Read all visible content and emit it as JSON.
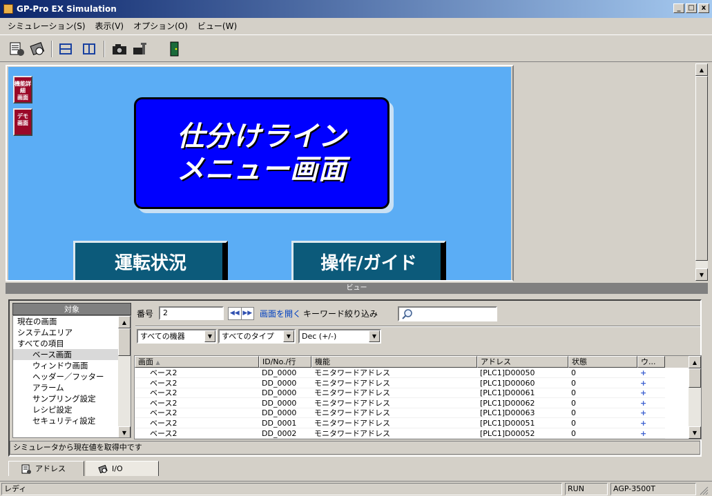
{
  "window": {
    "title": "GP-Pro EX Simulation",
    "min": "_",
    "max": "□",
    "close": "x"
  },
  "menu": [
    "シミュレーション(S)",
    "表示(V)",
    "オプション(O)",
    "ビュー(W)"
  ],
  "screen": {
    "side_buttons": [
      {
        "line1": "機能詳細",
        "line2": "画面"
      },
      {
        "line1": "デモ",
        "line2": "画面"
      }
    ],
    "title_line1": "仕分けライン",
    "title_line2": "メニュー画面",
    "btn_left": "運転状況",
    "btn_right": "操作/ガイド",
    "accent": "#5badf5"
  },
  "view_bar": "ビュー",
  "objects": {
    "header": "対象",
    "items": [
      {
        "label": "現在の画面",
        "sub": false,
        "selected": false
      },
      {
        "label": "システムエリア",
        "sub": false,
        "selected": false
      },
      {
        "label": "すべての項目",
        "sub": false,
        "selected": false
      },
      {
        "label": "ベース画面",
        "sub": true,
        "selected": true
      },
      {
        "label": "ウィンドウ画面",
        "sub": true,
        "selected": false
      },
      {
        "label": "ヘッダー／フッター",
        "sub": true,
        "selected": false
      },
      {
        "label": "アラーム",
        "sub": true,
        "selected": false
      },
      {
        "label": "サンプリング設定",
        "sub": true,
        "selected": false
      },
      {
        "label": "レシピ設定",
        "sub": true,
        "selected": false
      },
      {
        "label": "セキュリティ設定",
        "sub": true,
        "selected": false
      }
    ]
  },
  "filter": {
    "number_label": "番号",
    "number_value": "2",
    "open_screen": "画面を開く",
    "keyword_label": "キーワード絞り込み",
    "device": "すべての機器",
    "type": "すべてのタイプ",
    "format": "Dec (+/-)"
  },
  "table": {
    "columns": [
      "画面",
      "ID/No./行",
      "機能",
      "アドレス",
      "状態",
      "ウ..."
    ],
    "rows": [
      [
        "ベース2",
        "DD_0000",
        "モニタワードアドレス",
        "[PLC1]D00050",
        "0",
        "+"
      ],
      [
        "ベース2",
        "DD_0000",
        "モニタワードアドレス",
        "[PLC1]D00060",
        "0",
        "+"
      ],
      [
        "ベース2",
        "DD_0000",
        "モニタワードアドレス",
        "[PLC1]D00061",
        "0",
        "+"
      ],
      [
        "ベース2",
        "DD_0000",
        "モニタワードアドレス",
        "[PLC1]D00062",
        "0",
        "+"
      ],
      [
        "ベース2",
        "DD_0000",
        "モニタワードアドレス",
        "[PLC1]D00063",
        "0",
        "+"
      ],
      [
        "ベース2",
        "DD_0001",
        "モニタワードアドレス",
        "[PLC1]D00051",
        "0",
        "+"
      ],
      [
        "ベース2",
        "DD_0002",
        "モニタワードアドレス",
        "[PLC1]D00052",
        "0",
        "+"
      ]
    ]
  },
  "status_message": "シミュレータから現在値を取得中です",
  "tabs": [
    "アドレス",
    "I/O"
  ],
  "statusbar": {
    "left": "レディ",
    "run": "RUN",
    "model": "AGP-3500T"
  }
}
